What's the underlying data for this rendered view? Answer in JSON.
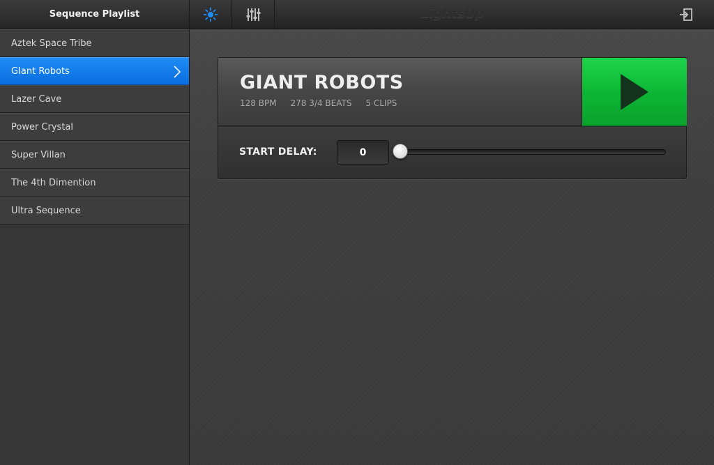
{
  "sidebar": {
    "title": "Sequence Playlist",
    "items": [
      {
        "label": "Aztek Space Tribe"
      },
      {
        "label": "GIant Robots"
      },
      {
        "label": "Lazer Cave"
      },
      {
        "label": "Power Crystal"
      },
      {
        "label": "Super Villan"
      },
      {
        "label": "The 4th Dimention"
      },
      {
        "label": "Ultra Sequence"
      }
    ],
    "selected_index": 1
  },
  "topbar": {
    "brand": "LightsUp",
    "tabs": [
      {
        "icon": "sun-icon",
        "active": true
      },
      {
        "icon": "mixer-sliders-icon",
        "active": false
      }
    ],
    "logout_icon": "logout-icon"
  },
  "sequence": {
    "title": "GIANT ROBOTS",
    "bpm": "128 BPM",
    "beats": "278 3/4 BEATS",
    "clips": "5 CLIPS"
  },
  "start_delay": {
    "label": "START DELAY:",
    "value": "0",
    "slider_fraction": 0
  },
  "colors": {
    "selection_blue": "#0f7ae8",
    "play_green": "#0cb533",
    "active_tab_icon": "#1e8ef5"
  }
}
